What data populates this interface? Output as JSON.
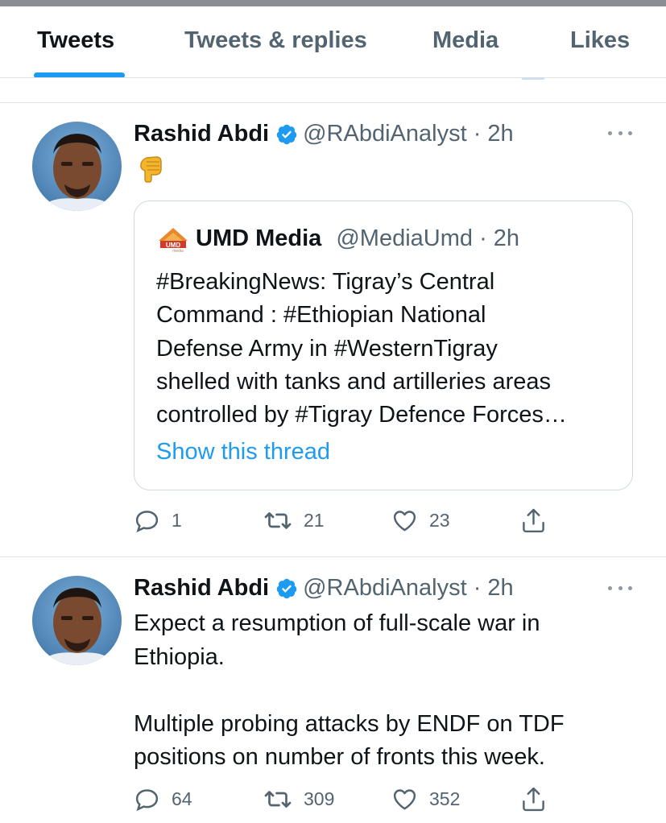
{
  "tabs": [
    {
      "label": "Tweets",
      "active": true
    },
    {
      "label": "Tweets & replies",
      "active": false
    },
    {
      "label": "Media",
      "active": false
    },
    {
      "label": "Likes",
      "active": false
    }
  ],
  "colors": {
    "accent": "#1d9bf0",
    "text": "#0f1419",
    "secondary": "#536471",
    "border": "#cfd9de"
  },
  "tweet1": {
    "name": "Rashid Abdi",
    "handle_time": "@RAbdiAnalyst · 2h",
    "emoji": "backhand-index-pointing-down",
    "quote": {
      "name": "UMD Media",
      "handle_time": "@MediaUmd · 2h",
      "text": "#BreakingNews: Tigray’s Central\nCommand : #Ethiopian National\nDefense Army  in #WesternTigray\nshelled with tanks and artilleries areas\ncontrolled by #Tigray Defence Forces…",
      "show_thread": "Show this thread"
    },
    "replies": "1",
    "retweets": "21",
    "likes": "23"
  },
  "tweet2": {
    "name": "Rashid Abdi",
    "handle_time": "@RAbdiAnalyst · 2h",
    "text": "Expect a resumption of full-scale war in\nEthiopia.\n\nMultiple probing attacks by ENDF on TDF\npositions on number of fronts this week.",
    "replies": "64",
    "retweets": "309",
    "likes": "352"
  },
  "icons": [
    "verified-badge-icon",
    "more-icon",
    "reply-icon",
    "retweet-icon",
    "like-icon",
    "share-icon"
  ]
}
